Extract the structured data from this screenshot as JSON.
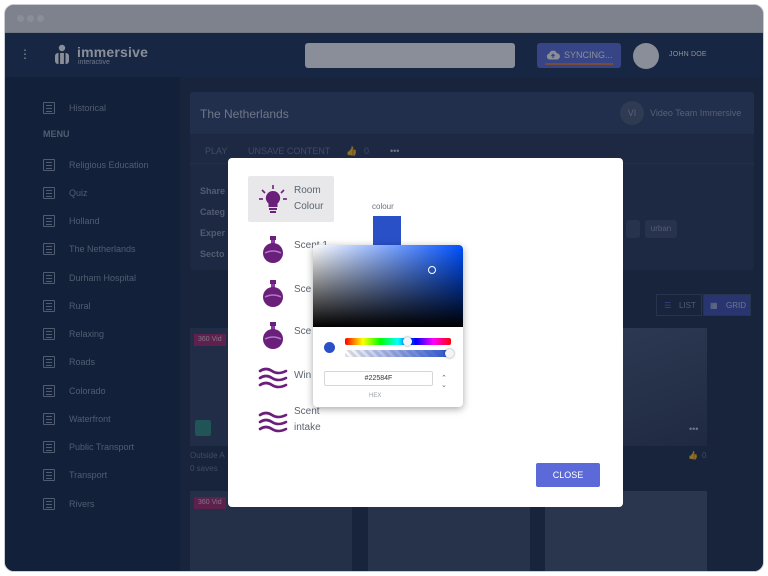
{
  "header": {
    "logo_text": "immersive",
    "logo_sub": "interactive",
    "search_placeholder": "",
    "sync_label": "SYNCING...",
    "user_name": "JOHN DOE"
  },
  "sidebar": {
    "top_item": "Historical",
    "menu_heading": "MENU",
    "items": [
      "Religious Education",
      "Quiz",
      "Holland",
      "The Netherlands",
      "Durham Hospital",
      "Rural",
      "Relaxing",
      "Roads",
      "Colorado",
      "Waterfront",
      "Public Transport",
      "Transport",
      "Rivers"
    ]
  },
  "detail": {
    "title": "The Netherlands",
    "owner_initials": "VI",
    "owner": "Video Team Immersive",
    "tabs": [
      "PLAY",
      "UNSAVE CONTENT"
    ],
    "likes": "0",
    "more": "•••",
    "fields": [
      "Share",
      "Categ",
      "Exper",
      "Secto"
    ],
    "chips": [
      "urban"
    ]
  },
  "grid": {
    "list_label": "LIST",
    "grid_label": "GRID",
    "tiles": [
      {
        "tag": "360 Vid",
        "title": "Outside A",
        "sub": "0 saves"
      },
      {
        "tag": "360 Vid"
      }
    ],
    "like_count": "0"
  },
  "modal": {
    "options": [
      {
        "label_1": "Room",
        "label_2": "Colour",
        "icon": "lightbulb-icon"
      },
      {
        "label_1": "Scent 1",
        "label_2": "",
        "icon": "perfume-icon"
      },
      {
        "label_1": "Sce",
        "label_2": "",
        "icon": "perfume-icon"
      },
      {
        "label_1": "Sce",
        "label_2": "",
        "icon": "perfume-icon"
      },
      {
        "label_1": "Win",
        "label_2": "",
        "icon": "wind-icon"
      },
      {
        "label_1": "Scent",
        "label_2": "intake",
        "icon": "wind-icon"
      }
    ],
    "colour_label": "colour",
    "close_label": "CLOSE"
  },
  "picker": {
    "hex_value": "#22584F",
    "mode_label": "HEX"
  },
  "colors": {
    "accent": "#5b6ad8",
    "sidebar": "#122240",
    "option_icon": "#6a1f7a"
  }
}
